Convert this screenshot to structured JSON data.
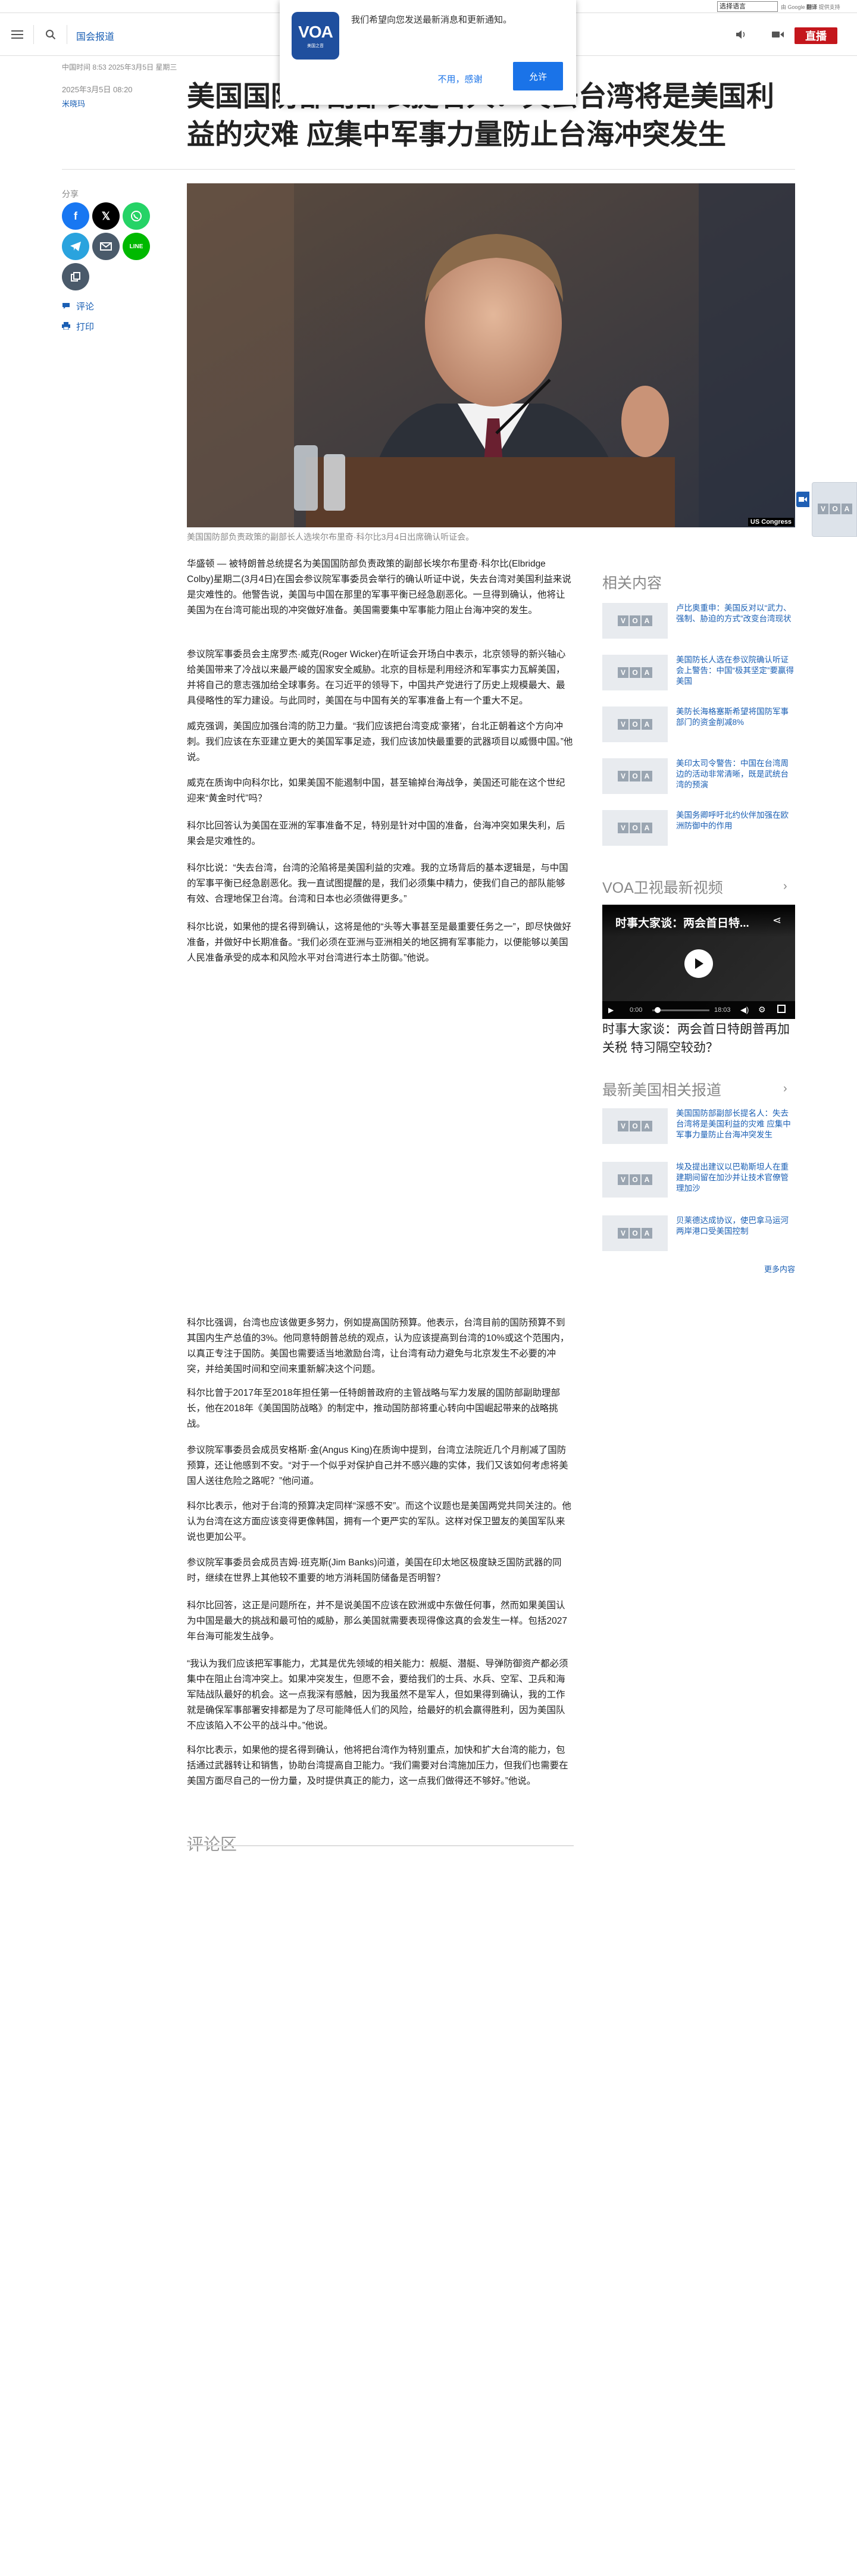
{
  "translate_bar": {
    "select_value": "选择语言",
    "powered_prefix": "由 Google",
    "powered_brand": "翻译",
    "powered_suffix": "提供支持"
  },
  "header": {
    "section_link": "国会报道",
    "live_label": "直播"
  },
  "notification": {
    "logo_text": "VOA",
    "logo_sub": "美国之音",
    "message": "我们希望向您发送最新消息和更新通知。",
    "decline_label": "不用，感谢",
    "accept_label": "允许"
  },
  "article": {
    "meta_top": "中国时间 8:53 2025年3月5日 星期三",
    "meta_date": "2025年3月5日 08:20",
    "author": "米晓玛",
    "title": "美国国防部副部长提名人：失去台湾将是美国利益的灾难 应集中军事力量防止台海冲突发生",
    "image_caption": "美国国防部负责政策的副部长人选埃尔布里奇·科尔比3月4日出席确认听证会。",
    "image_badge": "US Congress",
    "paragraphs_top": [
      "华盛顿 — 被特朗普总统提名为美国国防部负责政策的副部长埃尔布里奇·科尔比(Elbridge Colby)星期二(3月4日)在国会参议院军事委员会举行的确认听证中说，失去台湾对美国利益来说是灾难性的。他警告说，美国与中国在那里的军事平衡已经急剧恶化。一旦得到确认，他将让美国为在台湾可能出现的冲突做好准备。美国需要集中军事能力阻止台海冲突的发生。",
      "参议院军事委员会主席罗杰·威克(Roger Wicker)在听证会开场白中表示，北京领导的新兴轴心给美国带来了冷战以来最严峻的国家安全威胁。北京的目标是利用经济和军事实力瓦解美国，并将自己的意志强加给全球事务。在习近平的领导下，中国共产党进行了历史上规模最大、最具侵略性的军力建设。与此同时，美国在与中国有关的军事准备上有一个重大不足。",
      "威克强调，美国应加强台湾的防卫力量。“我们应该把台湾变成‘豪猪’，台北正朝着这个方向冲刺。我们应该在东亚建立更大的美国军事足迹，我们应该加快最重要的武器项目以威慑中国。”他说。",
      "威克在质询中向科尔比，如果美国不能遏制中国，甚至输掉台海战争，美国还可能在这个世纪迎来“黄金时代”吗？",
      "科尔比回答认为美国在亚洲的军事准备不足，特别是针对中国的准备，台海冲突如果失利，后果会是灾难性的。",
      "科尔比说：“失去台湾，台湾的沦陷将是美国利益的灾难。我的立场背后的基本逻辑是，与中国的军事平衡已经急剧恶化。我一直试图提醒的是，我们必须集中精力，使我们自己的部队能够有效、合理地保卫台湾。台湾和日本也必须做得更多。”",
      "科尔比说，如果他的提名得到确认，这将是他的“头等大事甚至是最重要任务之一”，即尽快做好准备，并做好中长期准备。“我们必须在亚洲与亚洲相关的地区拥有军事能力，以便能够以美国人民准备承受的成本和风险水平对台湾进行本土防御。”他说。"
    ],
    "paragraphs_bottom": [
      "科尔比强调，台湾也应该做更多努力，例如提高国防预算。他表示，台湾目前的国防预算不到其国内生产总值的3%。他同意特朗普总统的观点，认为应该提高到台湾的10%或这个范围内，以真正专注于国防。美国也需要适当地激励台湾，让台湾有动力避免与北京发生不必要的冲突，并给美国时间和空间来重新解决这个问题。",
      "科尔比曾于2017年至2018年担任第一任特朗普政府的主管战略与军力发展的国防部副助理部长，他在2018年《美国国防战略》的制定中，推动国防部将重心转向中国崛起带来的战略挑战。",
      "参议院军事委员会成员安格斯·金(Angus King)在质询中提到，台湾立法院近几个月削减了国防预算，还让他感到不安。“对于一个似乎对保护自己并不感兴趣的实体，我们又该如何考虑将美国人送往危险之路呢？”他问道。",
      "科尔比表示，他对于台湾的预算决定同样“深感不安”。而这个议题也是美国两党共同关注的。他认为台湾在这方面应该变得更像韩国，拥有一个更严实的军队。这样对保卫盟友的美国军队来说也更加公平。",
      "参议院军事委员会成员吉姆·班克斯(Jim Banks)问道，美国在印太地区极度缺乏国防武器的同时，继续在世界上其他较不重要的地方消耗国防储备是否明智？",
      "科尔比回答，这正是问题所在，并不是说美国不应该在欧洲或中东做任何事，然而如果美国认为中国是最大的挑战和最可怕的威胁，那么美国就需要表现得像这真的会发生一样。包括2027年台海可能发生战争。",
      "“我认为我们应该把军事能力，尤其是优先领域的相关能力：舰艇、潜艇、导弹防御资产都必须集中在阻止台湾冲突上。如果冲突发生，但愿不会，要给我们的士兵、水兵、空军、卫兵和海军陆战队最好的机会。这一点我深有感触，因为我虽然不是军人，但如果得到确认，我的工作就是确保军事部署安排都是为了尽可能降低人们的风险，给最好的机会赢得胜利，因为美国队不应该陷入不公平的战斗中。”他说。",
      "科尔比表示，如果他的提名得到确认，他将把台湾作为特别重点，加快和扩大台湾的能力，包括通过武器转让和销售，协助台湾提高自卫能力。“我们需要对台湾施加压力，但我们也需要在美国方面尽自己的一份力量，及时提供真正的能力，这一点我们做得还不够好。”他说。"
    ],
    "comments_title": "评论区"
  },
  "share": {
    "label": "分享",
    "comments_link": "评论",
    "print_link": "打印"
  },
  "sidebar": {
    "related_title": "相关内容",
    "related": [
      "卢比奥重申：美国反对以“武力、强制、胁迫的方式”改变台湾现状",
      "美国防长人选在参议院确认听证会上警告：中国“极其坚定”要赢得美国",
      "美防长海格塞斯希望将国防军事部门的资金削减8%",
      "美印太司令警告：中国在台湾周边的活动非常清晰，既是武统台湾的预演",
      "美国务卿呼吁北约伙伴加强在欧洲防御中的作用"
    ],
    "video_section_title": "VOA卫视最新视频",
    "video": {
      "overlay_title": "时事大家谈：两会首日特...",
      "time_current": "0:00",
      "time_total": "18:03",
      "title": "时事大家谈：两会首日特朗普再加关税 特习隔空较劲？"
    },
    "latest_title": "最新美国相关报道",
    "latest": [
      "美国国防部副部长提名人：失去台湾将是美国利益的灾难 应集中军事力量防止台海冲突发生",
      "埃及提出建议以巴勒斯坦人在重建期间留在加沙并让技术官僚管理加沙",
      "贝莱德达成协议，使巴拿马运河两岸港口受美国控制"
    ],
    "more_link": "更多内容"
  },
  "colors": {
    "live_red": "#c4161c",
    "link_blue": "#1a5fb4",
    "facebook": "#1877f2",
    "x": "#000000",
    "whatsapp": "#25d366",
    "telegram": "#2aa3de",
    "email": "#4a5a6a",
    "line": "#00b900",
    "voa_blue": "#1f4f9e"
  }
}
